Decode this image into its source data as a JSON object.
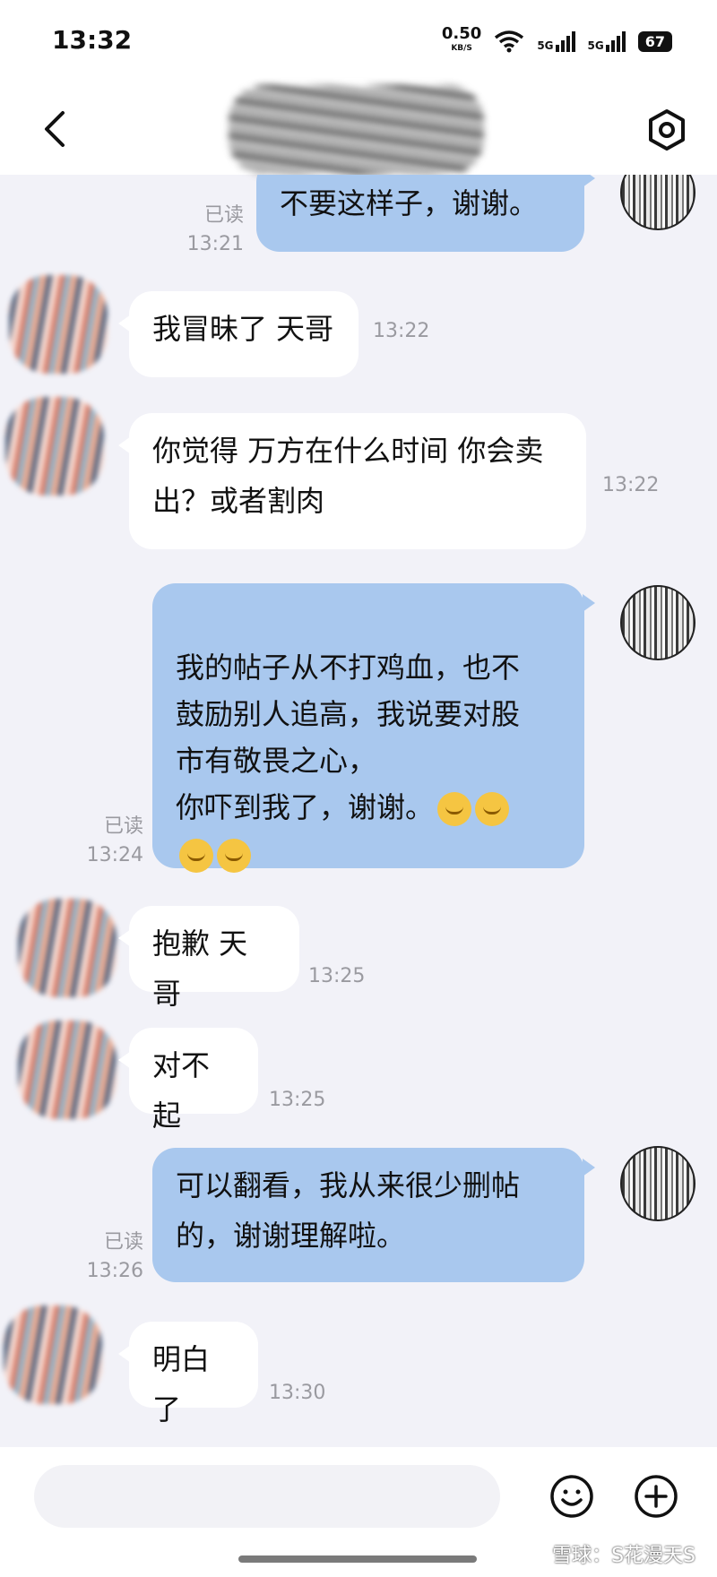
{
  "status_bar": {
    "time": "13:32",
    "net_speed": "0.50",
    "net_unit": "KB/S",
    "signal_1": "5G",
    "signal_2": "5G",
    "battery": "67"
  },
  "header": {
    "back_icon": "chevron-left-icon",
    "settings_icon": "settings-icon"
  },
  "messages": [
    {
      "side": "out",
      "text": "不要这样子，谢谢。",
      "read": "已读",
      "time": "13:21"
    },
    {
      "side": "in",
      "text": "我冒昧了 天哥",
      "time": "13:22"
    },
    {
      "side": "in",
      "text": "你觉得 万方在什么时间 你会卖\n出？或者割肉",
      "time": "13:22"
    },
    {
      "side": "out",
      "text": "我的帖子从不打鸡血，也不\n鼓励别人追高，我说要对股\n市有敬畏之心，\n你吓到我了，谢谢。",
      "read": "已读",
      "time": "13:24"
    },
    {
      "side": "in",
      "text": "抱歉 天哥",
      "time": "13:25"
    },
    {
      "side": "in",
      "text": "对不起",
      "time": "13:25"
    },
    {
      "side": "out",
      "text": "可以翻看，我从来很少删帖\n的，谢谢理解啦。",
      "read": "已读",
      "time": "13:26"
    },
    {
      "side": "in",
      "text": "明白了",
      "time": "13:30"
    }
  ],
  "input_bar": {
    "placeholder": "",
    "emoji_icon": "smiley-icon",
    "plus_icon": "plus-circle-icon"
  },
  "watermark": "雪球：S花漫天S"
}
